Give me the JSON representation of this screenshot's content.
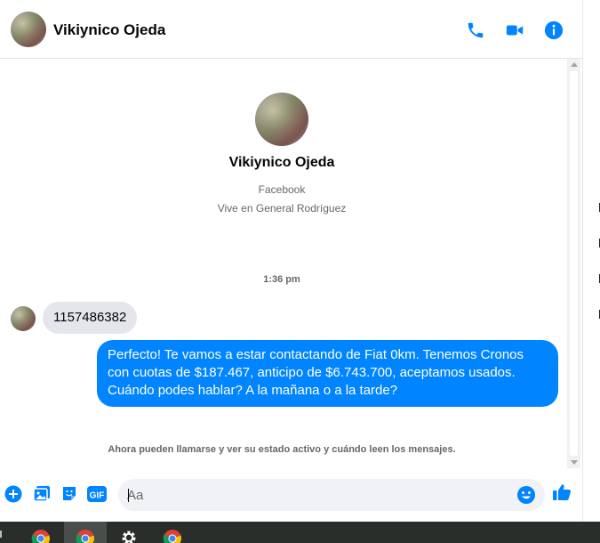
{
  "header": {
    "name": "Vikiynico Ojeda",
    "icons": [
      "phone-icon",
      "video-camera-icon",
      "info-icon"
    ]
  },
  "profile": {
    "name": "Vikiynico Ojeda",
    "source": "Facebook",
    "location": "Vive en General Rodríguez"
  },
  "conversation": {
    "timestamp": "1:36 pm",
    "incoming_message": "1157486382",
    "outgoing_message": "Perfecto! Te vamos a estar contactando de Fiat 0km. Tenemos Cronos con cuotas de $187.467, anticipo de $6.743.700, aceptamos usados. Cuándo podes hablar? A la mañana o a la tarde?",
    "notice": "Ahora pueden llamarse y ver su estado activo y cuándo leen los mensajes."
  },
  "composer": {
    "placeholder": "Aa",
    "value": "",
    "icons": [
      "plus-icon",
      "image-icon",
      "sticker-icon",
      "gif-icon",
      "emoji-icon",
      "thumbs-up-icon"
    ]
  },
  "colors": {
    "accent": "#0084ff",
    "incoming_bubble": "#e4e6eb",
    "secondary_text": "#65676b"
  },
  "taskbar": {
    "icons": [
      "chrome-icon",
      "chrome-icon",
      "settings-gear-icon",
      "chrome-icon"
    ]
  }
}
